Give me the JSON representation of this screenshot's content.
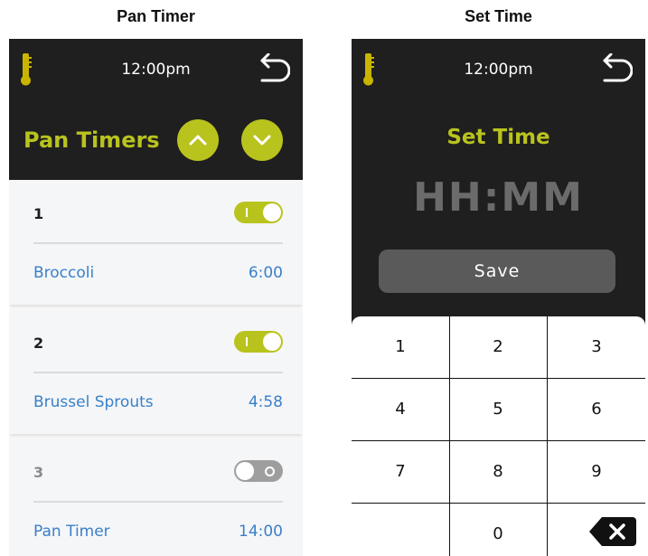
{
  "left_panel": {
    "caption": "Pan Timer"
  },
  "right_panel": {
    "caption": "Set Time"
  },
  "status": {
    "time": "12:00pm"
  },
  "pan_timers": {
    "title": "Pan Timers",
    "timers": [
      {
        "number": "1",
        "enabled": true,
        "name": "Broccoli",
        "time": "6:00"
      },
      {
        "number": "2",
        "enabled": true,
        "name": "Brussel Sprouts",
        "time": "4:58"
      },
      {
        "number": "3",
        "enabled": false,
        "name": "Pan Timer",
        "time": "14:00"
      }
    ]
  },
  "set_time": {
    "title": "Set Time",
    "display": "HH:MM",
    "save_label": "Save",
    "keys": [
      "1",
      "2",
      "3",
      "4",
      "5",
      "6",
      "7",
      "8",
      "9",
      "0"
    ]
  },
  "colors": {
    "accent": "#b9c31e",
    "screen_bg": "#1f1f1f",
    "link_blue": "#3a80c8",
    "save_button": "#5a5a5a"
  },
  "icons": [
    "thermometer-icon",
    "back-arrow-icon",
    "chevron-up-icon",
    "chevron-down-icon",
    "backspace-icon"
  ]
}
